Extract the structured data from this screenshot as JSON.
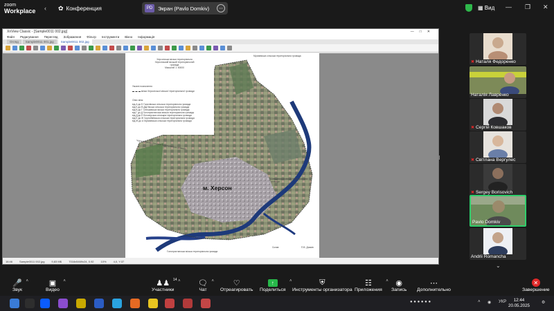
{
  "topbar": {
    "logo_line1": "zoom",
    "logo_line2": "Workplace",
    "conference_label": "Конференция",
    "share_initials": "PD",
    "share_label": "Экран (Pavlo Domkiv)",
    "view_label": "Вид",
    "shield_color": "#2eb84b"
  },
  "shared_app": {
    "title": "XnView Classic - [Sample0011 002.jpg]",
    "menu": [
      "Файл",
      "Редагування",
      "Перегляд",
      "Зображення",
      "Фільтр",
      "Інструменти",
      "Вікно",
      "Інформація"
    ],
    "tabs": [
      "Огляд",
      "Sample0011 001.jpg",
      "Sample0011 002.jpg"
    ],
    "active_tab": 2,
    "status": [
      "16:46",
      "Sample0011 002.jpg",
      "9,83 МБ",
      "7016x5469x24, 0.92",
      "10%",
      "4,0, Y:37"
    ],
    "map": {
      "header": [
        "Херсонська міська територіальна",
        "Херсонський міський територіальний громадa",
        "Масштаб 1: 50000"
      ],
      "legend_title": "Умовні позначення",
      "legend_item": "межа Херсонської міської територіальної громади",
      "list_title": "Опис меж:",
      "list_items": [
        "від А до Б Горохівська сільська територіальна громада",
        "від Б до В Дар'ївська сільська територіальна громада",
        "від В до Г Олешківська міська територіальна громада",
        "від Г до Д Голопристанська міська територіальна громада",
        "від Д до Е Білозерська селищна територіальна громада",
        "від Е до Ж Чорнобаївська сільська територіальна громада",
        "від Ж до А Музиківська сільська територіальна громада"
      ],
      "city": "м. Херсон",
      "neighbor_top": "Музиківська сільська територіальна громада",
      "neighbor_left": "Чорнобаївська сільська територіальна громада",
      "neighbor_bottom": "Голопристанська міська територіальна громада",
      "neighbor_right": "Олешківська міська територіальна громада",
      "signature_label": "Склав",
      "signature_name": "П.В. Домків"
    }
  },
  "participants": [
    {
      "name": "Наталя Федоренко",
      "muted": true,
      "color": "#c9a98e"
    },
    {
      "name": "Наталія Лавренко",
      "muted": false,
      "color": "#c79b84"
    },
    {
      "name": "Сергій Ковшаков",
      "muted": true,
      "color": "#b08a73"
    },
    {
      "name": "Світлана Вергулес",
      "muted": true,
      "color": "#d8b79c"
    },
    {
      "name": "Sergey Borisovich",
      "muted": true,
      "color": "#8b6f5c"
    },
    {
      "name": "Pavlo Domkiv",
      "muted": false,
      "color": "#9b8a6b"
    },
    {
      "name": "Andrii Romancha",
      "muted": false,
      "color": "#c3a38a"
    }
  ],
  "controls": {
    "audio": "Звук",
    "video": "Видео",
    "participants": "Участники",
    "participants_count": "14",
    "chat": "Чат",
    "react": "Отреагировать",
    "share": "Поделиться",
    "host_tools": "Инструменты организатора",
    "apps": "Приложения",
    "record": "Запись",
    "more": "Дополнительно",
    "end": "Завершение"
  },
  "taskbar": {
    "language": "УКР",
    "time": "12:44",
    "date": "20.05.2025"
  }
}
